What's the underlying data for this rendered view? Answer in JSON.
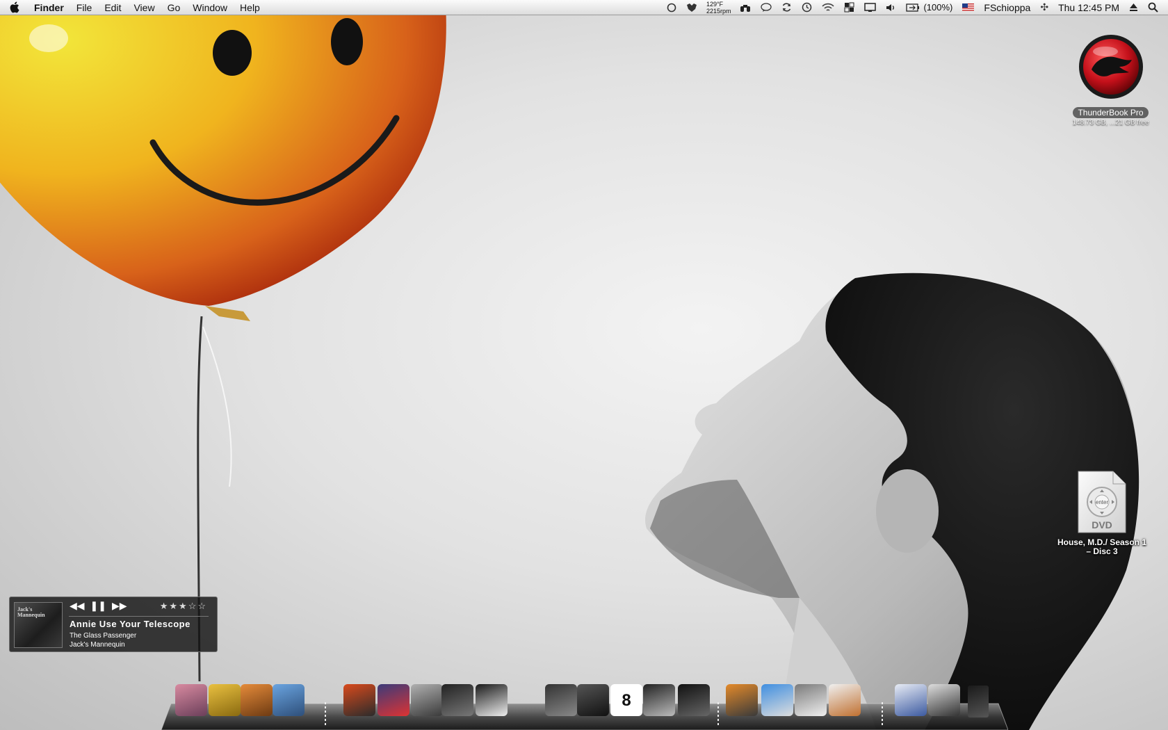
{
  "menubar": {
    "app_name": "Finder",
    "menus": [
      "File",
      "Edit",
      "View",
      "Go",
      "Window",
      "Help"
    ],
    "temperature": "129°F",
    "fan_speed": "2215rpm",
    "battery": "(100%)",
    "username": "FSchioppa",
    "clock": "Thu 12:45 PM"
  },
  "desktop": {
    "drive": {
      "name": "ThunderBook Pro",
      "info": "148.73 GB, ...21 GB free"
    },
    "dvd": {
      "badge": "DVD",
      "button": "enter",
      "name": "House, M.D./ Season 1 – Disc 3"
    }
  },
  "mini_player": {
    "album_art_text": "Jack's Mannequin",
    "title": "Annie Use Your Telescope",
    "album": "The Glass Passenger",
    "artist": "Jack's Mannequin",
    "rating_stars": 3,
    "rating_max": 5,
    "controls": {
      "prev": "◀◀",
      "pause": "❚❚",
      "next": "▶▶"
    }
  },
  "dock": {
    "apps": [
      {
        "name": "thundercat-1-icon",
        "colors": [
          "#d88aa0",
          "#6b3f5a"
        ]
      },
      {
        "name": "thundercat-2-icon",
        "colors": [
          "#e9c040",
          "#8a6a10"
        ]
      },
      {
        "name": "thundercat-3-icon",
        "colors": [
          "#e58b3a",
          "#6d3a12"
        ]
      },
      {
        "name": "thundercat-4-icon",
        "colors": [
          "#6aa4e0",
          "#2e4f7a"
        ]
      },
      {
        "name": "iphoto-icon",
        "colors": [
          "#d94a1c",
          "#2b2b2b"
        ]
      },
      {
        "name": "itunes-visualizer-icon",
        "colors": [
          "#3b3b7a",
          "#d33"
        ]
      },
      {
        "name": "garageband-icon",
        "colors": [
          "#b0b0b0",
          "#3a3a3a"
        ]
      },
      {
        "name": "quill-icon",
        "colors": [
          "#222222",
          "#777777"
        ]
      },
      {
        "name": "clapper-icon",
        "colors": [
          "#1a1a1a",
          "#eeeeee"
        ]
      },
      {
        "name": "resize-arrows-icon",
        "colors": [
          "#333333",
          "#888888"
        ]
      },
      {
        "name": "network-monitor-icon",
        "colors": [
          "#555555",
          "#111111"
        ]
      },
      {
        "name": "calendar-icon",
        "colors": [
          "#ffffff",
          "#222222"
        ]
      },
      {
        "name": "dashboard-widget-icon",
        "colors": [
          "#222222",
          "#bbbbbb"
        ]
      },
      {
        "name": "dashboard-icon",
        "colors": [
          "#111111",
          "#666666"
        ]
      },
      {
        "name": "tiger-icon",
        "colors": [
          "#e48a2a",
          "#3a3a3a"
        ]
      },
      {
        "name": "safari-icon",
        "colors": [
          "#3f8ee0",
          "#dddddd"
        ]
      },
      {
        "name": "printer-icon",
        "colors": [
          "#7a7a7a",
          "#f0f0f0"
        ]
      },
      {
        "name": "document-icon",
        "colors": [
          "#f0f0f0",
          "#c07030"
        ]
      },
      {
        "name": "window-thumbnail-1-icon",
        "colors": [
          "#e8ecf5",
          "#3c5aa0"
        ]
      },
      {
        "name": "window-thumbnail-2-icon",
        "colors": [
          "#dddddd",
          "#333333"
        ]
      },
      {
        "name": "trash-icon",
        "colors": [
          "#1a1a1a",
          "#555555"
        ]
      }
    ],
    "calendar_date": "8"
  }
}
